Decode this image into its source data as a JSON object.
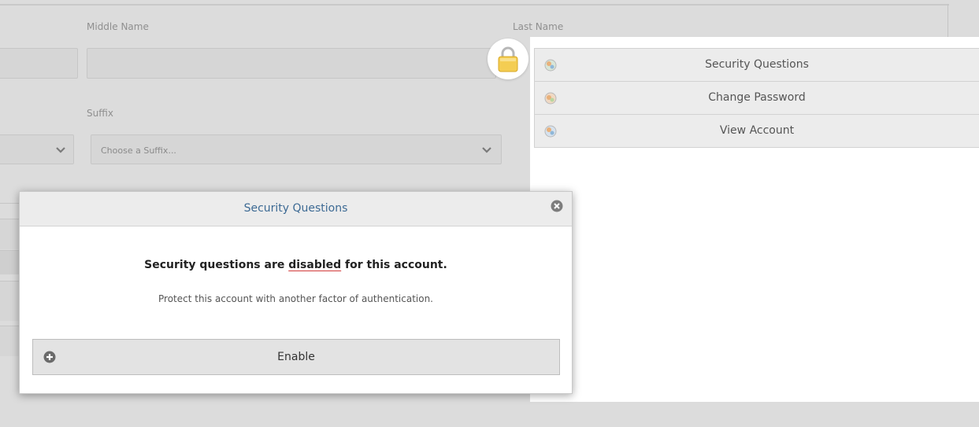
{
  "background_form": {
    "middle_name_label": "Middle Name",
    "last_name_label": "Last Name",
    "suffix_label": "Suffix",
    "suffix_select_value": "Choose a Suffix..."
  },
  "account_menu": {
    "items": [
      {
        "label": "Security Questions",
        "icon": "account-icon"
      },
      {
        "label": "Change Password",
        "icon": "account-icon"
      },
      {
        "label": "View Account",
        "icon": "account-icon"
      }
    ]
  },
  "security_modal": {
    "title": "Security Questions",
    "message_prefix": "Security questions are ",
    "message_highlight": "disabled",
    "message_suffix": " for this account.",
    "subtext": "Protect this account with another factor of authentication.",
    "enable_label": "Enable"
  },
  "colors": {
    "overlay_bg": "#dcdcdc",
    "title_blue": "#3d6a94",
    "highlight_underline": "#d23a3a",
    "lock_gold": "#f2c94c"
  }
}
